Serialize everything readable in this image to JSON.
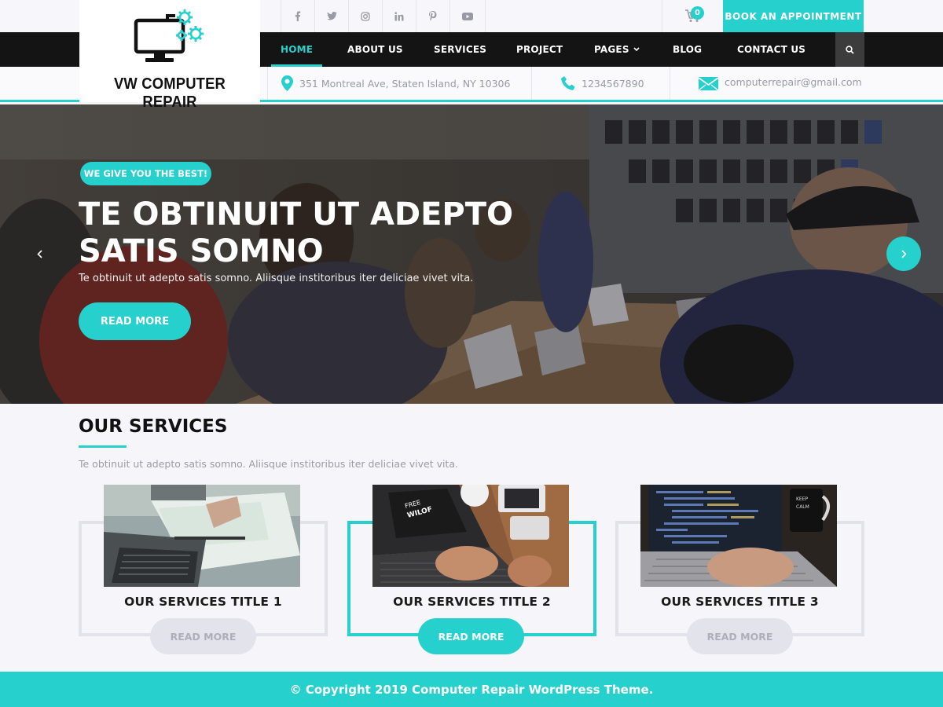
{
  "brand": {
    "name": "VW COMPUTER REPAIR"
  },
  "topbar": {
    "social_icons": [
      "facebook-icon",
      "twitter-icon",
      "instagram-icon",
      "linkedin-icon",
      "pinterest-icon",
      "youtube-icon"
    ],
    "cart_count": "0",
    "book_label": "BOOK AN APPOINTMENT"
  },
  "nav": {
    "items": [
      "HOME",
      "ABOUT US",
      "SERVICES",
      "PROJECT",
      "PAGES",
      "BLOG",
      "CONTACT US"
    ],
    "active": "HOME"
  },
  "contact": {
    "address": "351 Montreal Ave, Staten Island, NY 10306",
    "phone": "1234567890",
    "email": "computerrepair@gmail.com"
  },
  "hero": {
    "tag": "WE GIVE YOU THE BEST!",
    "title_line1": "TE OBTINUIT UT ADEPTO",
    "title_line2": "SATIS SOMNO",
    "subtitle": "Te obtinuit ut adepto satis somno. Aliisque institoribus iter deliciae vivet vita.",
    "button": "READ MORE"
  },
  "services": {
    "title": "OUR SERVICES",
    "subtitle": "Te obtinuit ut adepto satis somno. Aliisque institoribus iter deliciae vivet vita.",
    "cards": [
      {
        "title": "OUR SERVICES TITLE 1",
        "button": "READ MORE"
      },
      {
        "title": "OUR SERVICES TITLE 2",
        "button": "READ MORE"
      },
      {
        "title": "OUR SERVICES TITLE 3",
        "button": "READ MORE"
      }
    ]
  },
  "footer": {
    "copyright": "© Copyright 2019 Computer Repair WordPress Theme."
  },
  "colors": {
    "accent": "#25d0cd",
    "nav_bg": "#141414",
    "text_muted": "#9a9aa6"
  }
}
